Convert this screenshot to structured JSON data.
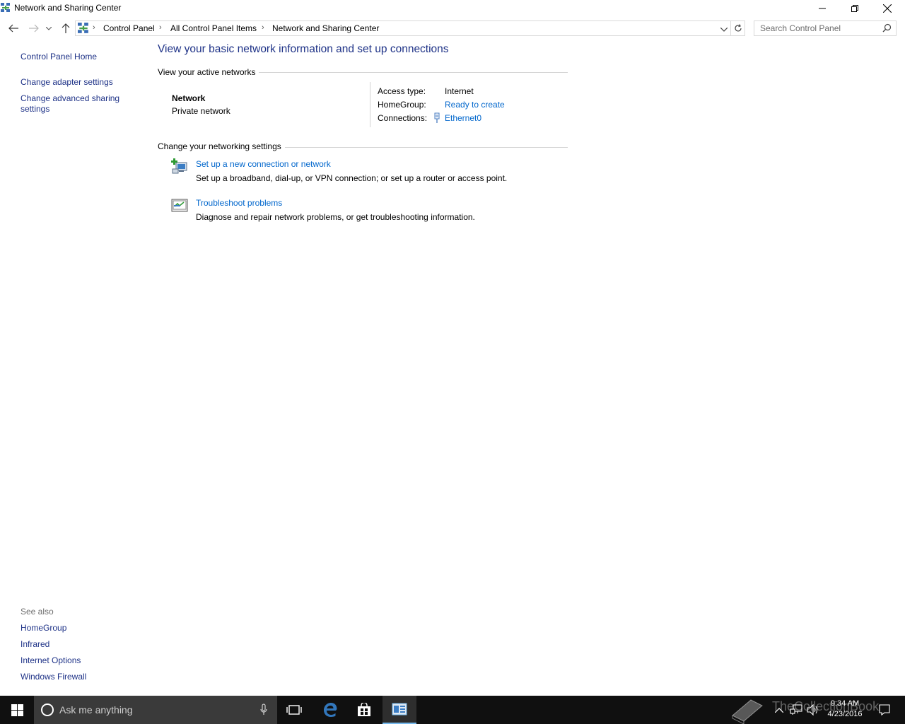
{
  "window": {
    "title": "Network and Sharing Center",
    "icon": "network-center-icon",
    "controls": {
      "minimize": "minimize-icon",
      "restore": "restore-icon",
      "close": "close-icon"
    }
  },
  "navigation": {
    "breadcrumbs": [
      "Control Panel",
      "All Control Panel Items",
      "Network and Sharing Center"
    ],
    "search_placeholder": "Search Control Panel"
  },
  "left_pane": {
    "home": "Control Panel Home",
    "links": [
      "Change adapter settings",
      "Change advanced sharing settings"
    ],
    "advanced_line1": "Change advanced sharing",
    "advanced_line2": "settings",
    "see_also_heading": "See also",
    "see_also": [
      "HomeGroup",
      "Infrared",
      "Internet Options",
      "Windows Firewall"
    ]
  },
  "main": {
    "title": "View your basic network information and set up connections",
    "active_networks_heading": "View your active networks",
    "network": {
      "name": "Network",
      "type": "Private network",
      "access_type_label": "Access type:",
      "access_type_value": "Internet",
      "homegroup_label": "HomeGroup:",
      "homegroup_value": "Ready to create",
      "connections_label": "Connections:",
      "connections_value": "Ethernet0"
    },
    "settings_heading": "Change your networking settings",
    "tasks": [
      {
        "link": "Set up a new connection or network",
        "description": "Set up a broadband, dial-up, or VPN connection; or set up a router or access point.",
        "icon": "new-connection-icon"
      },
      {
        "link": "Troubleshoot problems",
        "description": "Diagnose and repair network problems, or get troubleshooting information.",
        "icon": "troubleshoot-icon"
      }
    ]
  },
  "taskbar": {
    "search_placeholder": "Ask me anything",
    "clock_time": "9:34 AM",
    "clock_date": "4/23/2016",
    "watermark": "TheCollectionBook",
    "accent": "#76b9ed"
  },
  "colors": {
    "link": "#0066cc",
    "title": "#1e3287",
    "taskbar": "#101010"
  }
}
